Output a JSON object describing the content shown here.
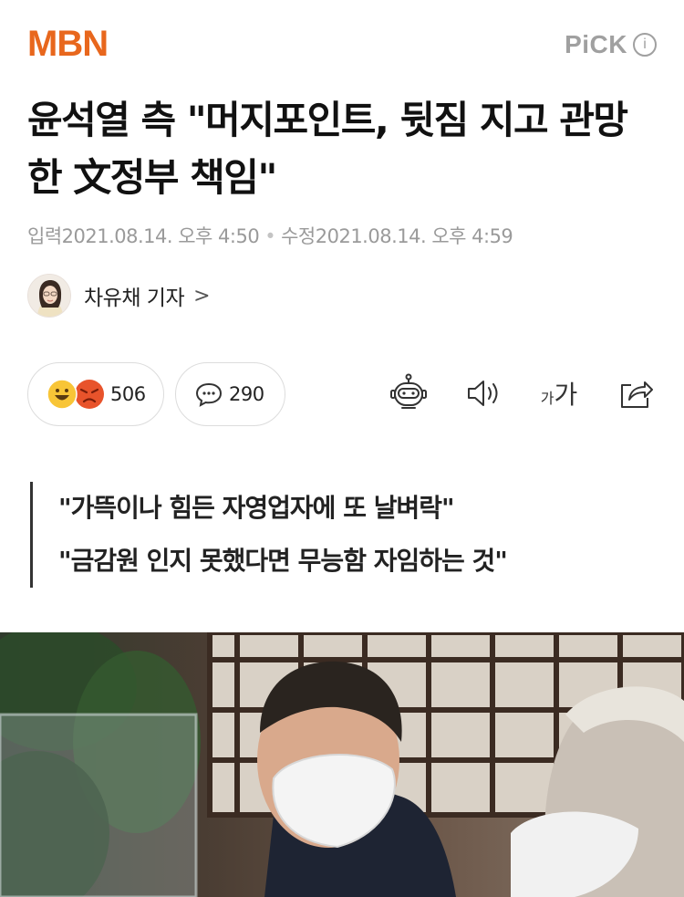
{
  "header": {
    "logo": "MBN",
    "pick_label": "PiCK",
    "pick_info": "i"
  },
  "article": {
    "headline": "윤석열 측 \"머지포인트, 뒷짐 지고 관망한 文정부 책임\"",
    "dates": {
      "input_label": "입력",
      "input_value": "2021.08.14. 오후 4:50",
      "modified_label": "수정",
      "modified_value": "2021.08.14. 오후 4:59"
    },
    "reporter": {
      "name": "차유채 기자",
      "chevron": ">"
    },
    "reactions": {
      "count": "506"
    },
    "comments": {
      "count": "290"
    },
    "font_size": {
      "small": "가",
      "large": "가"
    },
    "summary": [
      "\"가뜩이나 힘든 자영업자에 또 날벼락\"",
      "\"금감원 인지 못했다면 무능함 자임하는 것\""
    ]
  },
  "icons": {
    "reaction_1": "laughing-emoji-icon",
    "reaction_2": "angry-emoji-icon",
    "comment": "speech-bubble-icon",
    "tts": "robot-icon",
    "audio": "speaker-icon",
    "share": "share-icon"
  },
  "colors": {
    "brand": "#e8671d",
    "pick_gray": "#a0a0a0",
    "meta_gray": "#9a9a9a"
  }
}
